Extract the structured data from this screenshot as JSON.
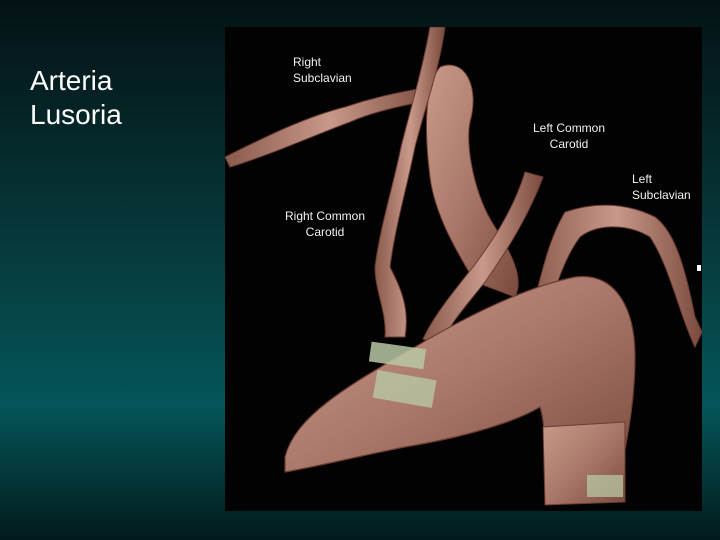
{
  "slide": {
    "title": "Arteria\nLusoria"
  },
  "image": {
    "labels": {
      "right_subclavian": "Right\nSubclavian",
      "left_common_carotid": "Left Common\nCarotid",
      "left_subclavian": "Left\nSubclavian",
      "right_common_carotid": "Right Common\nCarotid"
    }
  },
  "colors": {
    "background_top": "#041214",
    "background_mid": "#04565a",
    "vessel": "#b07f6e",
    "vessel_edge": "#6a3b30",
    "calcification": "#b8c7a4"
  }
}
